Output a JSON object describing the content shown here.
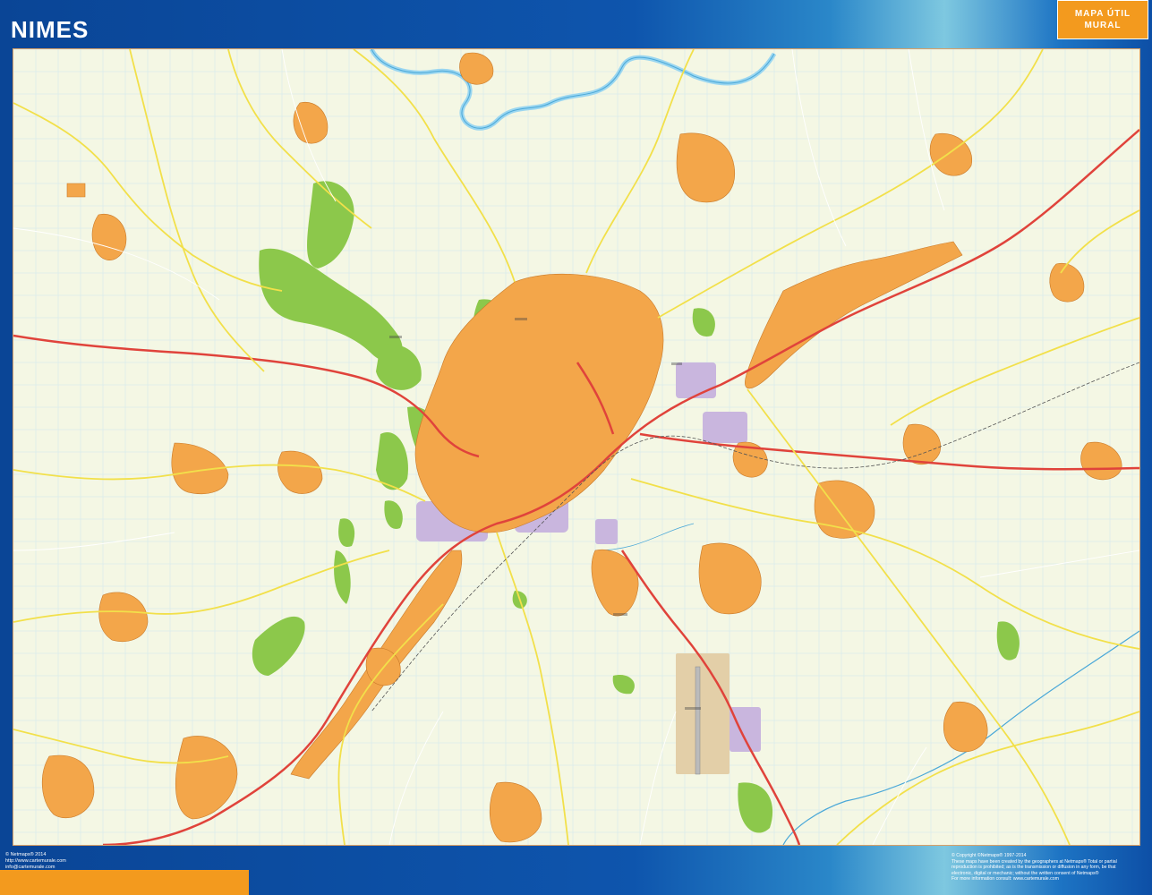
{
  "header": {
    "title": "NIMES",
    "badge_line1": "MAPA ÚTIL",
    "badge_line2": "MURAL"
  },
  "map": {
    "city": "NIMES",
    "colors": {
      "land": "#f4f7e4",
      "urban": "#f3a64a",
      "park": "#8cc84b",
      "industrial": "#c9b6de",
      "river": "#9ad6f0",
      "motorway": "#e0433b",
      "main_road": "#f2e04a",
      "grid": "#cfe6ef"
    }
  },
  "footer": {
    "left_line1": "© Netmaps® 2014",
    "left_line2": "http://www.cartemurale.com",
    "left_line3": "info@cartemurale.com",
    "right_line1": "© Copyright ©Netmaps® 1997-2014",
    "right_line2": "These maps have been created by the geographers at Netmaps® Total or partial",
    "right_line3": "reproduction is prohibited; as is the transmission or diffusion in any form, be that",
    "right_line4": "electronic, digital or mechanic; without the written consent of Netmaps®",
    "right_line5": "For more information consult: www.cartemurale.com"
  }
}
